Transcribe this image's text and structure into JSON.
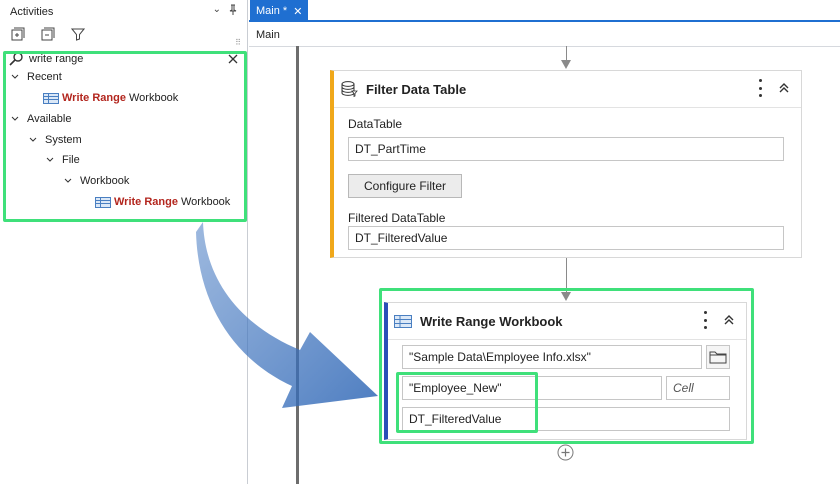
{
  "activities_panel": {
    "title": "Activities",
    "pin_glyph": "⌄",
    "search": {
      "value": "write range"
    },
    "tree": [
      {
        "label": "Recent"
      },
      {
        "label_hl": "Write Range",
        "label_rest": "Workbook"
      },
      {
        "label": "Available"
      },
      {
        "label": "System"
      },
      {
        "label": "File"
      },
      {
        "label": "Workbook"
      },
      {
        "label_hl": "Write Range",
        "label_rest": "Workbook"
      }
    ]
  },
  "designer": {
    "tab": {
      "label": "Main *",
      "close": "✕"
    },
    "breadcrumb": "Main",
    "filter_card": {
      "title": "Filter Data Table",
      "datatable_label": "DataTable",
      "datatable_value": "DT_PartTime",
      "configure_button": "Configure Filter",
      "filtered_label": "Filtered DataTable",
      "filtered_value": "DT_FilteredValue"
    },
    "write_card": {
      "title": "Write Range Workbook",
      "workbook_path": "\"Sample Data\\Employee Info.xlsx\"",
      "sheet_name": "\"Employee_New\"",
      "cell_placeholder": "Cell",
      "datatable_value": "DT_FilteredValue"
    }
  },
  "colors": {
    "highlight_green": "#3fe07a",
    "tab_blue": "#1f6fd1",
    "filter_accent": "#f0a81a",
    "write_accent": "#2b4fb8",
    "search_match": "#b3261e"
  },
  "icons": [
    "search-icon",
    "clear-search-icon",
    "expand-all-icon",
    "collapse-all-icon",
    "filter-icon",
    "pin-icon",
    "chevron-down-icon",
    "workbook-activity-icon",
    "database-icon",
    "more-options-icon",
    "collapse-up-icon",
    "folder-icon",
    "add-activity-icon"
  ]
}
